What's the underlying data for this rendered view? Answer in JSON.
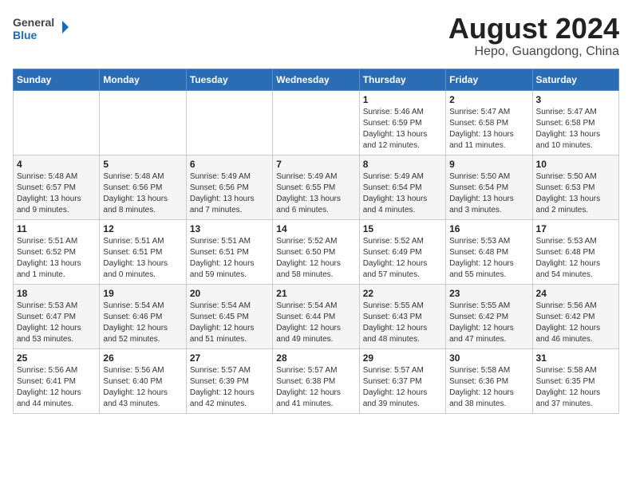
{
  "header": {
    "logo_general": "General",
    "logo_blue": "Blue",
    "title": "August 2024",
    "subtitle": "Hepo, Guangdong, China"
  },
  "weekdays": [
    "Sunday",
    "Monday",
    "Tuesday",
    "Wednesday",
    "Thursday",
    "Friday",
    "Saturday"
  ],
  "weeks": [
    [
      {
        "day": "",
        "info": ""
      },
      {
        "day": "",
        "info": ""
      },
      {
        "day": "",
        "info": ""
      },
      {
        "day": "",
        "info": ""
      },
      {
        "day": "1",
        "info": "Sunrise: 5:46 AM\nSunset: 6:59 PM\nDaylight: 13 hours\nand 12 minutes."
      },
      {
        "day": "2",
        "info": "Sunrise: 5:47 AM\nSunset: 6:58 PM\nDaylight: 13 hours\nand 11 minutes."
      },
      {
        "day": "3",
        "info": "Sunrise: 5:47 AM\nSunset: 6:58 PM\nDaylight: 13 hours\nand 10 minutes."
      }
    ],
    [
      {
        "day": "4",
        "info": "Sunrise: 5:48 AM\nSunset: 6:57 PM\nDaylight: 13 hours\nand 9 minutes."
      },
      {
        "day": "5",
        "info": "Sunrise: 5:48 AM\nSunset: 6:56 PM\nDaylight: 13 hours\nand 8 minutes."
      },
      {
        "day": "6",
        "info": "Sunrise: 5:49 AM\nSunset: 6:56 PM\nDaylight: 13 hours\nand 7 minutes."
      },
      {
        "day": "7",
        "info": "Sunrise: 5:49 AM\nSunset: 6:55 PM\nDaylight: 13 hours\nand 6 minutes."
      },
      {
        "day": "8",
        "info": "Sunrise: 5:49 AM\nSunset: 6:54 PM\nDaylight: 13 hours\nand 4 minutes."
      },
      {
        "day": "9",
        "info": "Sunrise: 5:50 AM\nSunset: 6:54 PM\nDaylight: 13 hours\nand 3 minutes."
      },
      {
        "day": "10",
        "info": "Sunrise: 5:50 AM\nSunset: 6:53 PM\nDaylight: 13 hours\nand 2 minutes."
      }
    ],
    [
      {
        "day": "11",
        "info": "Sunrise: 5:51 AM\nSunset: 6:52 PM\nDaylight: 13 hours\nand 1 minute."
      },
      {
        "day": "12",
        "info": "Sunrise: 5:51 AM\nSunset: 6:51 PM\nDaylight: 13 hours\nand 0 minutes."
      },
      {
        "day": "13",
        "info": "Sunrise: 5:51 AM\nSunset: 6:51 PM\nDaylight: 12 hours\nand 59 minutes."
      },
      {
        "day": "14",
        "info": "Sunrise: 5:52 AM\nSunset: 6:50 PM\nDaylight: 12 hours\nand 58 minutes."
      },
      {
        "day": "15",
        "info": "Sunrise: 5:52 AM\nSunset: 6:49 PM\nDaylight: 12 hours\nand 57 minutes."
      },
      {
        "day": "16",
        "info": "Sunrise: 5:53 AM\nSunset: 6:48 PM\nDaylight: 12 hours\nand 55 minutes."
      },
      {
        "day": "17",
        "info": "Sunrise: 5:53 AM\nSunset: 6:48 PM\nDaylight: 12 hours\nand 54 minutes."
      }
    ],
    [
      {
        "day": "18",
        "info": "Sunrise: 5:53 AM\nSunset: 6:47 PM\nDaylight: 12 hours\nand 53 minutes."
      },
      {
        "day": "19",
        "info": "Sunrise: 5:54 AM\nSunset: 6:46 PM\nDaylight: 12 hours\nand 52 minutes."
      },
      {
        "day": "20",
        "info": "Sunrise: 5:54 AM\nSunset: 6:45 PM\nDaylight: 12 hours\nand 51 minutes."
      },
      {
        "day": "21",
        "info": "Sunrise: 5:54 AM\nSunset: 6:44 PM\nDaylight: 12 hours\nand 49 minutes."
      },
      {
        "day": "22",
        "info": "Sunrise: 5:55 AM\nSunset: 6:43 PM\nDaylight: 12 hours\nand 48 minutes."
      },
      {
        "day": "23",
        "info": "Sunrise: 5:55 AM\nSunset: 6:42 PM\nDaylight: 12 hours\nand 47 minutes."
      },
      {
        "day": "24",
        "info": "Sunrise: 5:56 AM\nSunset: 6:42 PM\nDaylight: 12 hours\nand 46 minutes."
      }
    ],
    [
      {
        "day": "25",
        "info": "Sunrise: 5:56 AM\nSunset: 6:41 PM\nDaylight: 12 hours\nand 44 minutes."
      },
      {
        "day": "26",
        "info": "Sunrise: 5:56 AM\nSunset: 6:40 PM\nDaylight: 12 hours\nand 43 minutes."
      },
      {
        "day": "27",
        "info": "Sunrise: 5:57 AM\nSunset: 6:39 PM\nDaylight: 12 hours\nand 42 minutes."
      },
      {
        "day": "28",
        "info": "Sunrise: 5:57 AM\nSunset: 6:38 PM\nDaylight: 12 hours\nand 41 minutes."
      },
      {
        "day": "29",
        "info": "Sunrise: 5:57 AM\nSunset: 6:37 PM\nDaylight: 12 hours\nand 39 minutes."
      },
      {
        "day": "30",
        "info": "Sunrise: 5:58 AM\nSunset: 6:36 PM\nDaylight: 12 hours\nand 38 minutes."
      },
      {
        "day": "31",
        "info": "Sunrise: 5:58 AM\nSunset: 6:35 PM\nDaylight: 12 hours\nand 37 minutes."
      }
    ]
  ]
}
